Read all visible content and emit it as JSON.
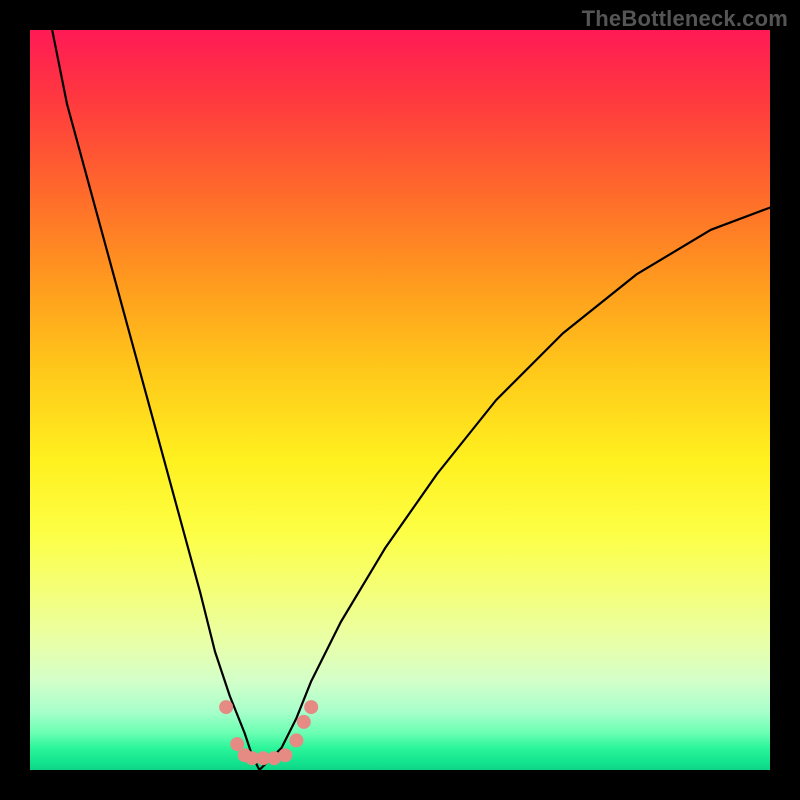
{
  "watermark": "TheBottleneck.com",
  "chart_data": {
    "type": "line",
    "title": "",
    "xlabel": "",
    "ylabel": "",
    "xlim": [
      0,
      100
    ],
    "ylim": [
      0,
      100
    ],
    "grid": false,
    "legend": false,
    "background_gradient": {
      "direction": "vertical",
      "stops": [
        {
          "pos": 0,
          "color": "#ff1a55"
        },
        {
          "pos": 50,
          "color": "#fff01f"
        },
        {
          "pos": 100,
          "color": "#0fd487"
        }
      ]
    },
    "series": [
      {
        "name": "bottleneck-curve",
        "color": "#000000",
        "x": [
          3,
          5,
          8,
          11,
          14,
          17,
          20,
          23,
          25,
          27,
          29,
          30,
          31,
          32,
          34,
          36,
          38,
          42,
          48,
          55,
          63,
          72,
          82,
          92,
          100
        ],
        "y": [
          100,
          90,
          79,
          68,
          57,
          46,
          35,
          24,
          16,
          10,
          5,
          2,
          0,
          1,
          3,
          7,
          12,
          20,
          30,
          40,
          50,
          59,
          67,
          73,
          76
        ]
      }
    ],
    "markers": {
      "name": "highlight-dots",
      "color": "#e58b84",
      "radius_px": 7,
      "points": [
        {
          "x": 26.5,
          "y": 8.5
        },
        {
          "x": 28.0,
          "y": 3.5
        },
        {
          "x": 29.0,
          "y": 2.0
        },
        {
          "x": 30.0,
          "y": 1.6
        },
        {
          "x": 31.5,
          "y": 1.6
        },
        {
          "x": 33.0,
          "y": 1.6
        },
        {
          "x": 34.5,
          "y": 2.0
        },
        {
          "x": 36.0,
          "y": 4.0
        },
        {
          "x": 37.0,
          "y": 6.5
        },
        {
          "x": 38.0,
          "y": 8.5
        }
      ]
    }
  }
}
